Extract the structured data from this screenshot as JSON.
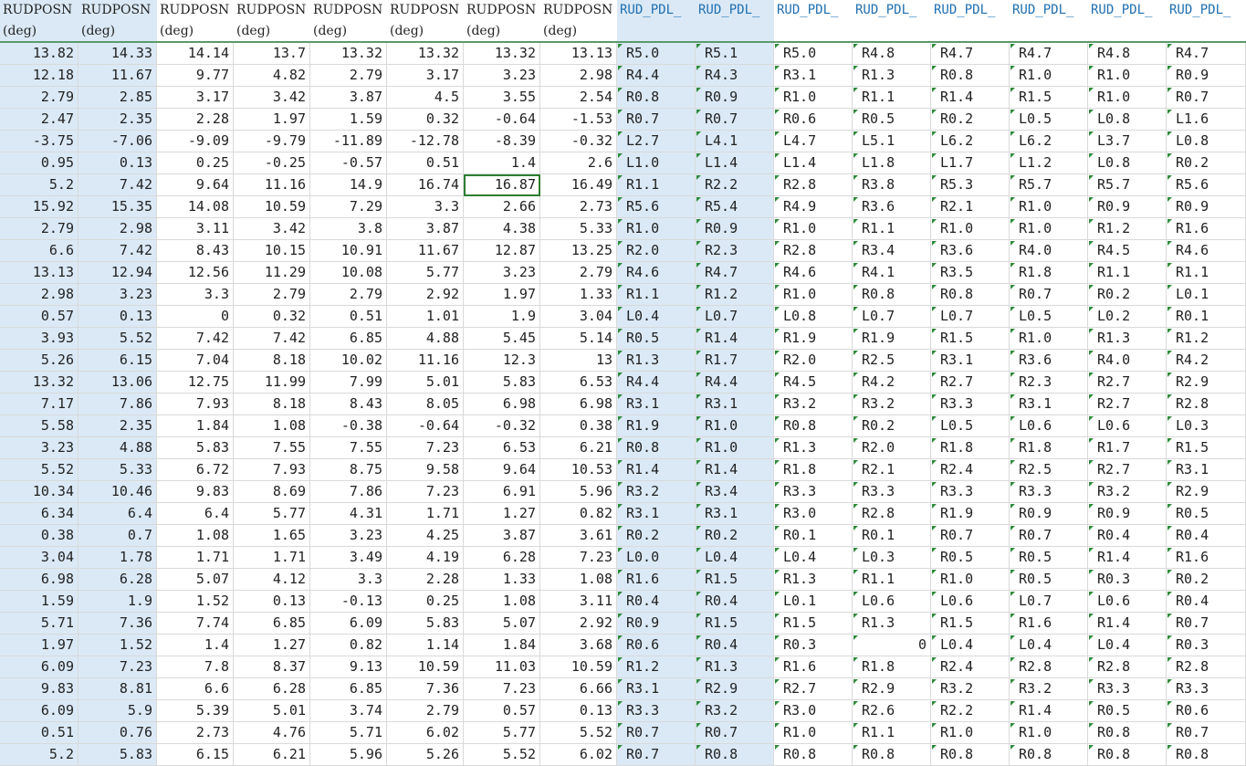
{
  "sheet": {
    "headers": [
      "RUDPOSN",
      "RUDPOSN",
      "RUDPOSN",
      "RUDPOSN",
      "RUDPOSN",
      "RUDPOSN",
      "RUDPOSN",
      "RUDPOSN",
      "RUD_PDL_",
      "RUD_PDL_",
      "RUD_PDL_",
      "RUD_PDL_",
      "RUD_PDL_",
      "RUD_PDL_",
      "RUD_PDL_",
      "RUD_PDL_"
    ],
    "units": [
      "(deg)",
      "(deg)",
      "(deg)",
      "(deg)",
      "(deg)",
      "(deg)",
      "(deg)",
      "(deg)",
      "",
      "",
      "",
      "",
      "",
      "",
      "",
      ""
    ],
    "rows": [
      [
        "13.82",
        "14.33",
        "14.14",
        "13.7",
        "13.32",
        "13.32",
        "13.32",
        "13.13",
        "R5.0",
        "R5.1",
        "R5.0",
        "R4.8",
        "R4.7",
        "R4.7",
        "R4.8",
        "R4.7"
      ],
      [
        "12.18",
        "11.67",
        "9.77",
        "4.82",
        "2.79",
        "3.17",
        "3.23",
        "2.98",
        "R4.4",
        "R4.3",
        "R3.1",
        "R1.3",
        "R0.8",
        "R1.0",
        "R1.0",
        "R0.9"
      ],
      [
        "2.79",
        "2.85",
        "3.17",
        "3.42",
        "3.87",
        "4.5",
        "3.55",
        "2.54",
        "R0.8",
        "R0.9",
        "R1.0",
        "R1.1",
        "R1.4",
        "R1.5",
        "R1.0",
        "R0.7"
      ],
      [
        "2.47",
        "2.35",
        "2.28",
        "1.97",
        "1.59",
        "0.32",
        "-0.64",
        "-1.53",
        "R0.7",
        "R0.7",
        "R0.6",
        "R0.5",
        "R0.2",
        "L0.5",
        "L0.8",
        "L1.6"
      ],
      [
        "-3.75",
        "-7.06",
        "-9.09",
        "-9.79",
        "-11.89",
        "-12.78",
        "-8.39",
        "-0.32",
        "L2.7",
        "L4.1",
        "L4.7",
        "L5.1",
        "L6.2",
        "L6.2",
        "L3.7",
        "L0.8"
      ],
      [
        "0.95",
        "0.13",
        "0.25",
        "-0.25",
        "-0.57",
        "0.51",
        "1.4",
        "2.6",
        "L1.0",
        "L1.4",
        "L1.4",
        "L1.8",
        "L1.7",
        "L1.2",
        "L0.8",
        "R0.2"
      ],
      [
        "5.2",
        "7.42",
        "9.64",
        "11.16",
        "14.9",
        "16.74",
        "16.87",
        "16.49",
        "R1.1",
        "R2.2",
        "R2.8",
        "R3.8",
        "R5.3",
        "R5.7",
        "R5.7",
        "R5.6"
      ],
      [
        "15.92",
        "15.35",
        "14.08",
        "10.59",
        "7.29",
        "3.3",
        "2.66",
        "2.73",
        "R5.6",
        "R5.4",
        "R4.9",
        "R3.6",
        "R2.1",
        "R1.0",
        "R0.9",
        "R0.9"
      ],
      [
        "2.79",
        "2.98",
        "3.11",
        "3.42",
        "3.8",
        "3.87",
        "4.38",
        "5.33",
        "R1.0",
        "R0.9",
        "R1.0",
        "R1.1",
        "R1.0",
        "R1.0",
        "R1.2",
        "R1.6"
      ],
      [
        "6.6",
        "7.42",
        "8.43",
        "10.15",
        "10.91",
        "11.67",
        "12.87",
        "13.25",
        "R2.0",
        "R2.3",
        "R2.8",
        "R3.4",
        "R3.6",
        "R4.0",
        "R4.5",
        "R4.6"
      ],
      [
        "13.13",
        "12.94",
        "12.56",
        "11.29",
        "10.08",
        "5.77",
        "3.23",
        "2.79",
        "R4.6",
        "R4.7",
        "R4.6",
        "R4.1",
        "R3.5",
        "R1.8",
        "R1.1",
        "R1.1"
      ],
      [
        "2.98",
        "3.23",
        "3.3",
        "2.79",
        "2.79",
        "2.92",
        "1.97",
        "1.33",
        "R1.1",
        "R1.2",
        "R1.0",
        "R0.8",
        "R0.8",
        "R0.7",
        "R0.2",
        "L0.1"
      ],
      [
        "0.57",
        "0.13",
        "0",
        "0.32",
        "0.51",
        "1.01",
        "1.9",
        "3.04",
        "L0.4",
        "L0.7",
        "L0.8",
        "L0.7",
        "L0.7",
        "L0.5",
        "L0.2",
        "R0.1"
      ],
      [
        "3.93",
        "5.52",
        "7.42",
        "7.42",
        "6.85",
        "4.88",
        "5.45",
        "5.14",
        "R0.5",
        "R1.4",
        "R1.9",
        "R1.9",
        "R1.5",
        "R1.0",
        "R1.3",
        "R1.2"
      ],
      [
        "5.26",
        "6.15",
        "7.04",
        "8.18",
        "10.02",
        "11.16",
        "12.3",
        "13",
        "R1.3",
        "R1.7",
        "R2.0",
        "R2.5",
        "R3.1",
        "R3.6",
        "R4.0",
        "R4.2"
      ],
      [
        "13.32",
        "13.06",
        "12.75",
        "11.99",
        "7.99",
        "5.01",
        "5.83",
        "6.53",
        "R4.4",
        "R4.4",
        "R4.5",
        "R4.2",
        "R2.7",
        "R2.3",
        "R2.7",
        "R2.9"
      ],
      [
        "7.17",
        "7.86",
        "7.93",
        "8.18",
        "8.43",
        "8.05",
        "6.98",
        "6.98",
        "R3.1",
        "R3.1",
        "R3.2",
        "R3.2",
        "R3.3",
        "R3.1",
        "R2.7",
        "R2.8"
      ],
      [
        "5.58",
        "2.35",
        "1.84",
        "1.08",
        "-0.38",
        "-0.64",
        "-0.32",
        "0.38",
        "R1.9",
        "R1.0",
        "R0.8",
        "R0.2",
        "L0.5",
        "L0.6",
        "L0.6",
        "L0.3"
      ],
      [
        "3.23",
        "4.88",
        "5.83",
        "7.55",
        "7.55",
        "7.23",
        "6.53",
        "6.21",
        "R0.8",
        "R1.0",
        "R1.3",
        "R2.0",
        "R1.8",
        "R1.8",
        "R1.7",
        "R1.5"
      ],
      [
        "5.52",
        "5.33",
        "6.72",
        "7.93",
        "8.75",
        "9.58",
        "9.64",
        "10.53",
        "R1.4",
        "R1.4",
        "R1.8",
        "R2.1",
        "R2.4",
        "R2.5",
        "R2.7",
        "R3.1"
      ],
      [
        "10.34",
        "10.46",
        "9.83",
        "8.69",
        "7.86",
        "7.23",
        "6.91",
        "5.96",
        "R3.2",
        "R3.4",
        "R3.3",
        "R3.3",
        "R3.3",
        "R3.3",
        "R3.2",
        "R2.9"
      ],
      [
        "6.34",
        "6.4",
        "6.4",
        "5.77",
        "4.31",
        "1.71",
        "1.27",
        "0.82",
        "R3.1",
        "R3.1",
        "R3.0",
        "R2.8",
        "R1.9",
        "R0.9",
        "R0.9",
        "R0.5"
      ],
      [
        "0.38",
        "0.7",
        "1.08",
        "1.65",
        "3.23",
        "4.25",
        "3.87",
        "3.61",
        "R0.2",
        "R0.2",
        "R0.1",
        "R0.1",
        "R0.7",
        "R0.7",
        "R0.4",
        "R0.4"
      ],
      [
        "3.04",
        "1.78",
        "1.71",
        "1.71",
        "3.49",
        "4.19",
        "6.28",
        "7.23",
        "L0.0",
        "L0.4",
        "L0.4",
        "L0.3",
        "R0.5",
        "R0.5",
        "R1.4",
        "R1.6"
      ],
      [
        "6.98",
        "6.28",
        "5.07",
        "4.12",
        "3.3",
        "2.28",
        "1.33",
        "1.08",
        "R1.6",
        "R1.5",
        "R1.3",
        "R1.1",
        "R1.0",
        "R0.5",
        "R0.3",
        "R0.2"
      ],
      [
        "1.59",
        "1.9",
        "1.52",
        "0.13",
        "-0.13",
        "0.25",
        "1.08",
        "3.11",
        "R0.4",
        "R0.4",
        "L0.1",
        "L0.6",
        "L0.6",
        "L0.7",
        "L0.6",
        "R0.4"
      ],
      [
        "5.71",
        "7.36",
        "7.74",
        "6.85",
        "6.09",
        "5.83",
        "5.07",
        "2.92",
        "R0.9",
        "R1.5",
        "R1.5",
        "R1.3",
        "R1.5",
        "R1.6",
        "R1.4",
        "R0.7"
      ],
      [
        "1.97",
        "1.52",
        "1.4",
        "1.27",
        "0.82",
        "1.14",
        "1.84",
        "3.68",
        "R0.6",
        "R0.4",
        "R0.3",
        "0",
        "L0.4",
        "L0.4",
        "L0.4",
        "R0.3"
      ],
      [
        "6.09",
        "7.23",
        "7.8",
        "8.37",
        "9.13",
        "10.59",
        "11.03",
        "10.59",
        "R1.2",
        "R1.3",
        "R1.6",
        "R1.8",
        "R2.4",
        "R2.8",
        "R2.8",
        "R2.8"
      ],
      [
        "9.83",
        "8.81",
        "6.6",
        "6.28",
        "6.85",
        "7.36",
        "7.23",
        "6.66",
        "R3.1",
        "R2.9",
        "R2.7",
        "R2.9",
        "R3.2",
        "R3.2",
        "R3.3",
        "R3.3"
      ],
      [
        "6.09",
        "5.9",
        "5.39",
        "5.01",
        "3.74",
        "2.79",
        "0.57",
        "0.13",
        "R3.3",
        "R3.2",
        "R3.0",
        "R2.6",
        "R2.2",
        "R1.4",
        "R0.5",
        "R0.6"
      ],
      [
        "0.51",
        "0.76",
        "2.73",
        "4.76",
        "5.71",
        "6.02",
        "5.77",
        "5.52",
        "R0.7",
        "R0.7",
        "R1.0",
        "R1.1",
        "R1.0",
        "R1.0",
        "R0.8",
        "R0.7"
      ],
      [
        "5.2",
        "5.83",
        "6.15",
        "6.21",
        "5.96",
        "5.26",
        "5.52",
        "6.02",
        "R0.7",
        "R0.8",
        "R0.8",
        "R0.8",
        "R0.8",
        "R0.8",
        "R0.8",
        "R0.8"
      ]
    ],
    "active_cell_value": "16.87",
    "colors": {
      "selection": "#dbe9f6",
      "header_text_blue": "#1f6fb0",
      "active_border": "#2e7d32",
      "error_triangle": "#2e8b3a",
      "gridline": "#d9d9d9"
    }
  }
}
